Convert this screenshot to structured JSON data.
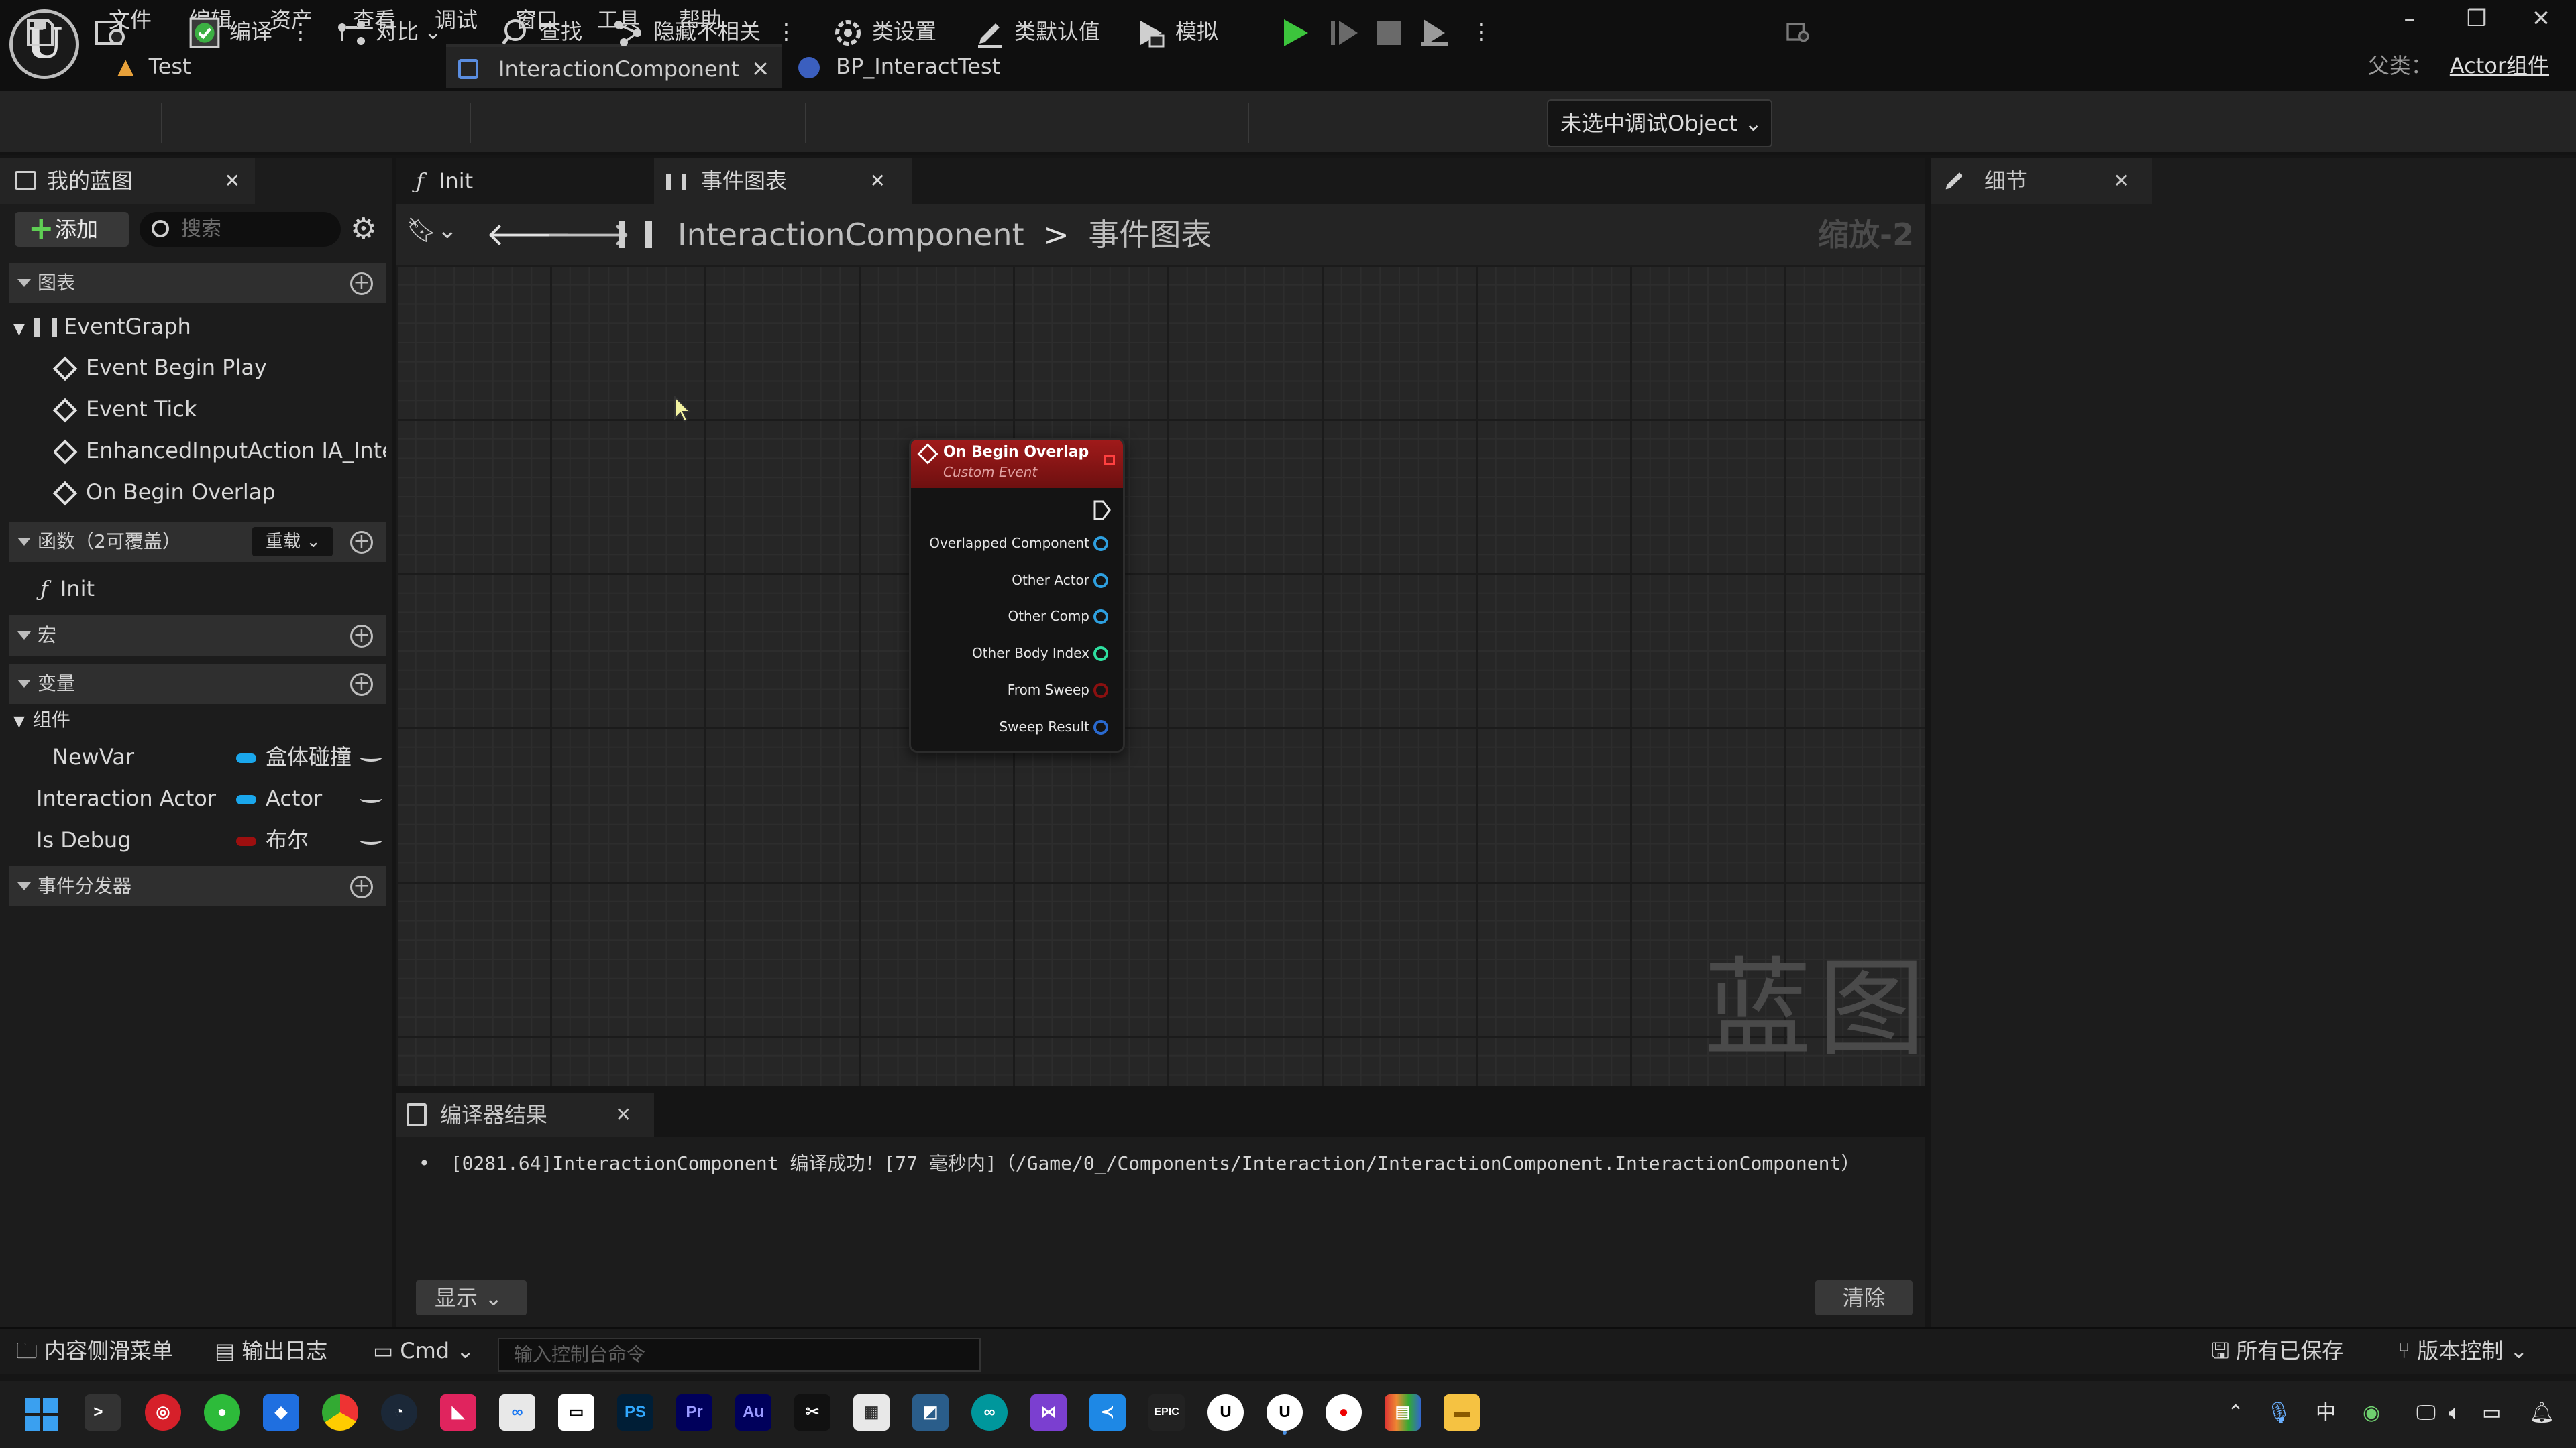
{
  "menu": [
    "文件",
    "编辑",
    "资产",
    "查看",
    "调试",
    "窗口",
    "工具",
    "帮助"
  ],
  "window_tabs": {
    "test": "Test",
    "interaction": "InteractionComponent",
    "bp": "BP_InteractTest"
  },
  "parent": {
    "label": "父类：",
    "value": "Actor组件"
  },
  "toolbar": {
    "compile": "编译",
    "diff": "对比",
    "find": "查找",
    "hide": "隐藏不相关",
    "class_settings": "类设置",
    "class_defaults": "类默认值",
    "simulate": "模拟",
    "debug_object": "未选中调试Object"
  },
  "left_panel": {
    "tab": "我的蓝图",
    "add": "添加",
    "search_placeholder": "搜索",
    "graphs_section": "图表",
    "event_graph": "EventGraph",
    "events": [
      "Event Begin Play",
      "Event Tick",
      "EnhancedInputAction IA_Intera",
      "On Begin Overlap"
    ],
    "functions_section": "函数（2可覆盖）",
    "override": "重载",
    "function_init": "Init",
    "macros_section": "宏",
    "variables_section": "变量",
    "components_group": "组件",
    "variables": [
      {
        "name": "NewVar",
        "type": "盒体碰撞",
        "color": "#1aa7ec"
      },
      {
        "name": "Interaction Actor",
        "type": "Actor",
        "color": "#1aa7ec"
      },
      {
        "name": "Is Debug",
        "type": "布尔",
        "color": "#9d0f0f"
      }
    ],
    "dispatchers_section": "事件分发器"
  },
  "doc_tabs": {
    "init": "Init",
    "event_graph": "事件图表"
  },
  "breadcrumb": {
    "component": "InteractionComponent",
    "sep": ">",
    "graph": "事件图表"
  },
  "zoom": "缩放-2",
  "watermark": "蓝图",
  "node": {
    "title": "On Begin Overlap",
    "subtitle": "Custom Event",
    "pins": [
      "Overlapped Component",
      "Other Actor",
      "Other Comp",
      "Other Body Index",
      "From Sweep",
      "Sweep Result"
    ],
    "pin_colors": [
      "#2ea0e0",
      "#2ea0e0",
      "#2ea0e0",
      "#2ee0a0",
      "#8a1010",
      "#2a6ad0"
    ]
  },
  "compiler": {
    "tab": "编译器结果",
    "message": "[0281.64]InteractionComponent 编译成功！[77 毫秒内]（/Game/0_/Components/Interaction/InteractionComponent.InteractionComponent）",
    "show": "显示",
    "clear": "清除"
  },
  "details": {
    "tab": "细节"
  },
  "statusbar": {
    "content_drawer": "内容侧滑菜单",
    "output_log": "输出日志",
    "cmd": "Cmd",
    "console_placeholder": "输入控制台命令",
    "all_saved": "所有已保存",
    "source_control": "版本控制"
  },
  "taskbar": {
    "apps": [
      "PS",
      "Pr",
      "Au"
    ],
    "ime": "中"
  }
}
